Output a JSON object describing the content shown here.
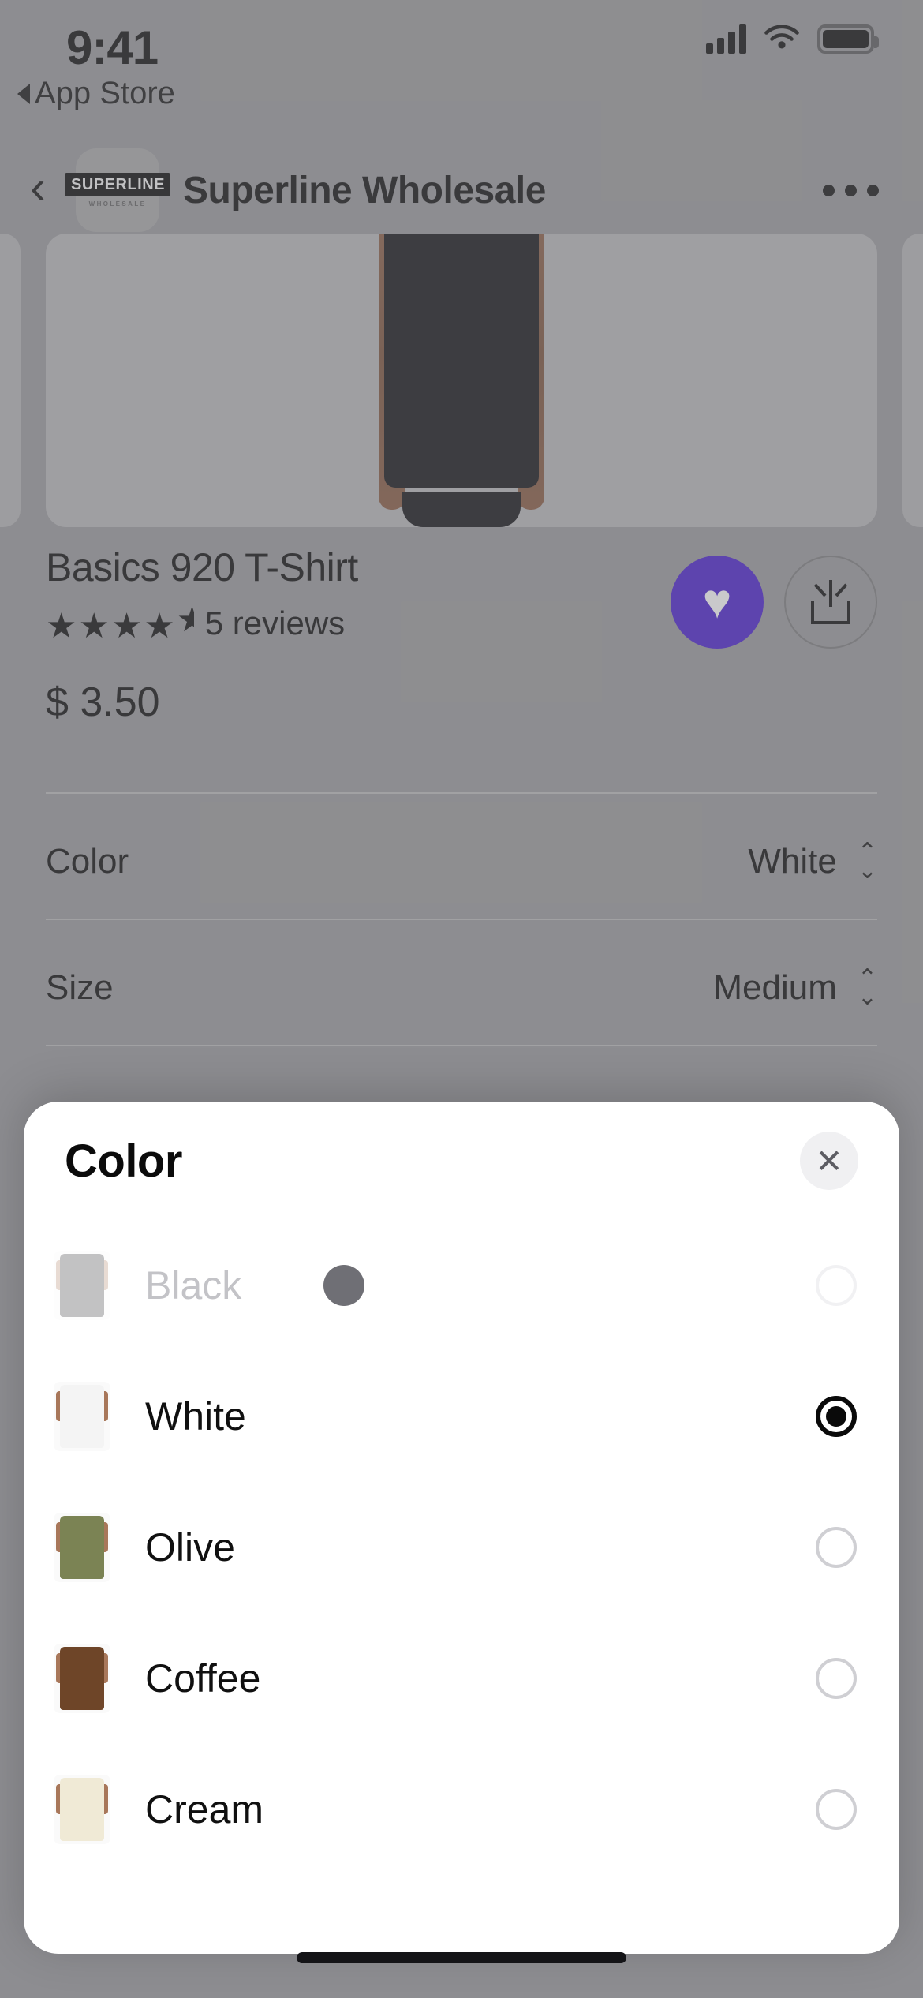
{
  "status_bar": {
    "time": "9:41",
    "back_label": "App Store",
    "signal_icon": "cellular-bars-icon",
    "wifi_icon": "wifi-icon",
    "battery_icon": "battery-icon"
  },
  "nav_bar": {
    "back_icon": "chevron-left-icon",
    "app_logo_mark": "SUPERLINE",
    "app_logo_sub": "WHOLESALE",
    "title": "Superline Wholesale",
    "more_icon": "ellipsis-icon"
  },
  "product": {
    "title": "Basics 920 T-Shirt",
    "stars": "★★★★",
    "half_star": "★",
    "rating_value": 4.5,
    "reviews_label": "5 reviews",
    "review_count": 5,
    "price": "$ 3.50",
    "favorite_icon": "heart-icon",
    "favorite_active": true,
    "share_icon": "share-icon",
    "accent_color": "#4b22cf"
  },
  "options": [
    {
      "label": "Color",
      "value": "White",
      "chevron_icon": "chevron-up-down-icon"
    },
    {
      "label": "Size",
      "value": "Medium",
      "chevron_icon": "chevron-up-down-icon"
    }
  ],
  "sheet": {
    "title": "Color",
    "close_icon": "close-icon",
    "close_label": "✕",
    "items": [
      {
        "name": "Black",
        "swatch": "#17161a",
        "sleeve": "#a8775a",
        "selected": false,
        "disabled": true,
        "loading": true
      },
      {
        "name": "White",
        "swatch": "#f4f4f4",
        "sleeve": "#a8775a",
        "selected": true,
        "disabled": false,
        "loading": false
      },
      {
        "name": "Olive",
        "swatch": "#7b8354",
        "sleeve": "#a8775a",
        "selected": false,
        "disabled": false,
        "loading": false
      },
      {
        "name": "Coffee",
        "swatch": "#6e4528",
        "sleeve": "#a8775a",
        "selected": false,
        "disabled": false,
        "loading": false
      },
      {
        "name": "Cream",
        "swatch": "#f0ead6",
        "sleeve": "#a8775a",
        "selected": false,
        "disabled": false,
        "loading": false
      }
    ]
  },
  "home_indicator": "home-indicator"
}
